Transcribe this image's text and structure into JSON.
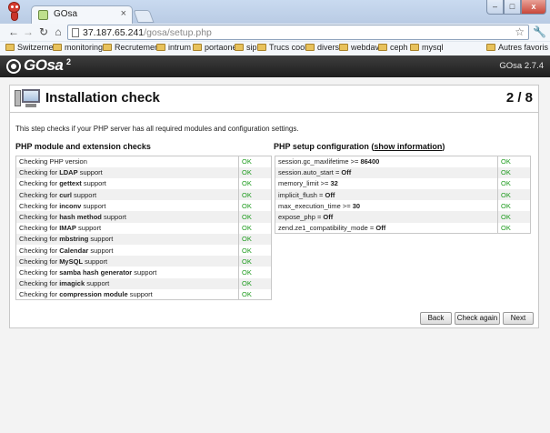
{
  "browser": {
    "tab_title": "GOsa",
    "tab_close": "×",
    "url_host": "37.187.65.241",
    "url_path": "/gosa/setup.php",
    "window_buttons": {
      "minimize": "–",
      "maximize": "□",
      "close": "x"
    },
    "nav": {
      "back": "←",
      "forward": "→",
      "reload": "↻",
      "home": "⌂"
    },
    "bookmarks": [
      "Switzernet",
      "monitoring",
      "Recrutement",
      "intrum",
      "portaone",
      "sip",
      "Trucs cool",
      "divers",
      "webdav",
      "ceph",
      "mysql"
    ],
    "other_bookmarks": "Autres favoris"
  },
  "app": {
    "logo_text": "GOsa",
    "logo_sup": "2",
    "version": "GOsa 2.7.4"
  },
  "page": {
    "title": "Installation check",
    "step": "2 / 8",
    "intro": "This step checks if your PHP server has all required modules and configuration settings."
  },
  "php_modules": {
    "title": "PHP module and extension checks",
    "rows": [
      {
        "pre": "Checking PHP version",
        "bold": "",
        "post": "",
        "status": "OK"
      },
      {
        "pre": "Checking for ",
        "bold": "LDAP",
        "post": " support",
        "status": "OK"
      },
      {
        "pre": "Checking for ",
        "bold": "gettext",
        "post": " support",
        "status": "OK"
      },
      {
        "pre": "Checking for ",
        "bold": "curl",
        "post": " support",
        "status": "OK"
      },
      {
        "pre": "Checking for ",
        "bold": "inconv",
        "post": " support",
        "status": "OK"
      },
      {
        "pre": "Checking for ",
        "bold": "hash method",
        "post": " support",
        "status": "OK"
      },
      {
        "pre": "Checking for ",
        "bold": "IMAP",
        "post": " support",
        "status": "OK"
      },
      {
        "pre": "Checking for ",
        "bold": "mbstring",
        "post": " support",
        "status": "OK"
      },
      {
        "pre": "Checking for ",
        "bold": "Calendar",
        "post": " support",
        "status": "OK"
      },
      {
        "pre": "Checking for ",
        "bold": "MySQL",
        "post": " support",
        "status": "OK"
      },
      {
        "pre": "Checking for ",
        "bold": "samba hash generator",
        "post": " support",
        "status": "OK"
      },
      {
        "pre": "Checking for ",
        "bold": "imagick",
        "post": " support",
        "status": "OK"
      },
      {
        "pre": "Checking for ",
        "bold": "compression module",
        "post": " support",
        "status": "OK"
      }
    ]
  },
  "php_setup": {
    "title": "PHP setup configuration (",
    "link": "show information",
    "title_end": ")",
    "rows": [
      {
        "pre": "session.gc_maxlifetime >= ",
        "bold": "86400",
        "status": "OK"
      },
      {
        "pre": "session.auto_start = ",
        "bold": "Off",
        "status": "OK"
      },
      {
        "pre": "memory_limit >= ",
        "bold": "32",
        "status": "OK"
      },
      {
        "pre": "implicit_flush = ",
        "bold": "Off",
        "status": "OK"
      },
      {
        "pre": "max_execution_time >= ",
        "bold": "30",
        "status": "OK"
      },
      {
        "pre": "expose_php = ",
        "bold": "Off",
        "status": "OK"
      },
      {
        "pre": "zend.ze1_compatibility_mode = ",
        "bold": "Off",
        "status": "OK"
      }
    ]
  },
  "buttons": {
    "back": "Back",
    "check_again": "Check again",
    "next": "Next"
  },
  "colors": {
    "ok": "#1c9a1c",
    "header_bg": "#2e2e2e"
  }
}
